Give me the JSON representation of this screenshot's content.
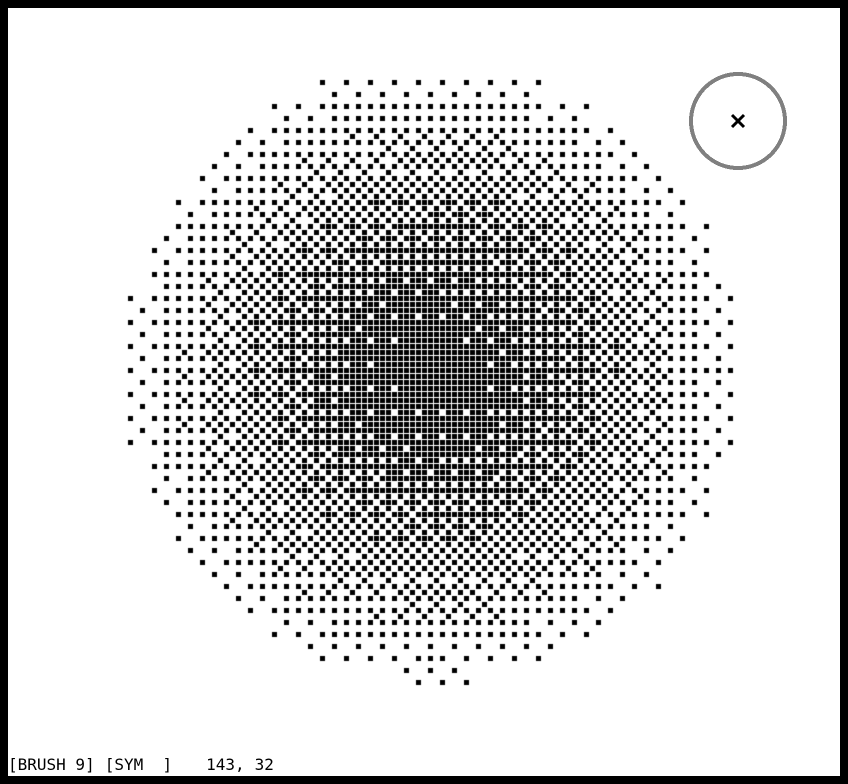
{
  "app": {
    "background_color": "#000000",
    "canvas_color": "#ffffff",
    "ink_color": "#000000",
    "cursor_color": "#808080"
  },
  "canvas": {
    "content": "dithered circular spray of black pixel dots",
    "brush_cursor_icon": "crosshair-x-icon"
  },
  "status": {
    "brush": "[BRUSH 9]",
    "symmetry": "[SYM  ]",
    "cursor_x": "143,",
    "cursor_y": "32"
  }
}
